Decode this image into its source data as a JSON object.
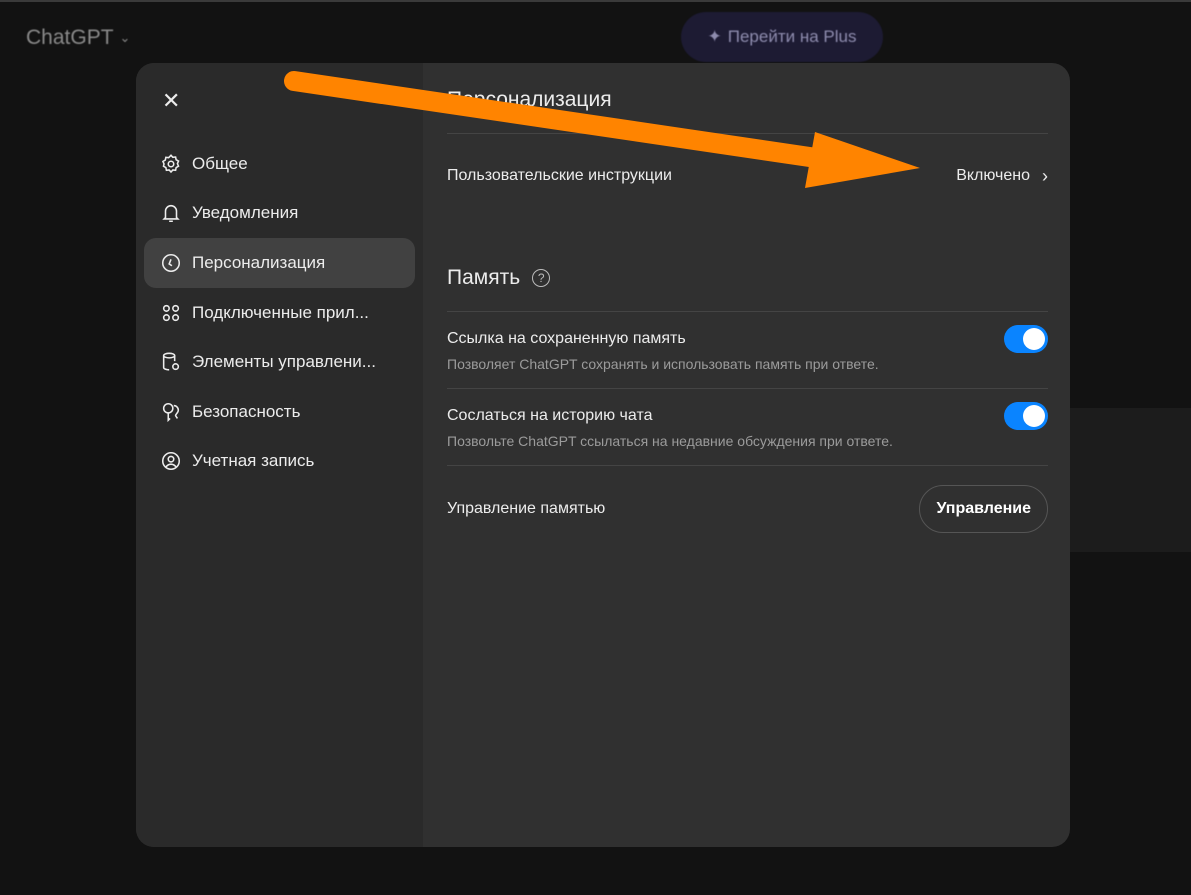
{
  "background": {
    "brand": "ChatGPT",
    "upgrade_button": "Перейти на Plus"
  },
  "sidebar": {
    "items": [
      {
        "label": "Общее",
        "icon": "gear-icon"
      },
      {
        "label": "Уведомления",
        "icon": "bell-icon"
      },
      {
        "label": "Персонализация",
        "icon": "personalization-icon",
        "active": true
      },
      {
        "label": "Подключенные прил...",
        "icon": "apps-icon"
      },
      {
        "label": "Элементы управлени...",
        "icon": "database-gear-icon"
      },
      {
        "label": "Безопасность",
        "icon": "key-icon"
      },
      {
        "label": "Учетная запись",
        "icon": "user-icon"
      }
    ]
  },
  "main": {
    "title": "Персонализация",
    "custom_instructions": {
      "label": "Пользовательские инструкции",
      "value": "Включено"
    },
    "memory": {
      "title": "Память",
      "saved_memory": {
        "label": "Ссылка на сохраненную память",
        "desc": "Позволяет ChatGPT сохранять и использовать память при ответе.",
        "on": true
      },
      "chat_history": {
        "label": "Сослаться на историю чата",
        "desc": "Позвольте ChatGPT ссылаться на недавние обсуждения при ответе.",
        "on": true
      },
      "manage": {
        "label": "Управление памятью",
        "button": "Управление"
      }
    }
  },
  "colors": {
    "accent": "#0a84ff",
    "annotation_arrow": "#ff8400"
  }
}
